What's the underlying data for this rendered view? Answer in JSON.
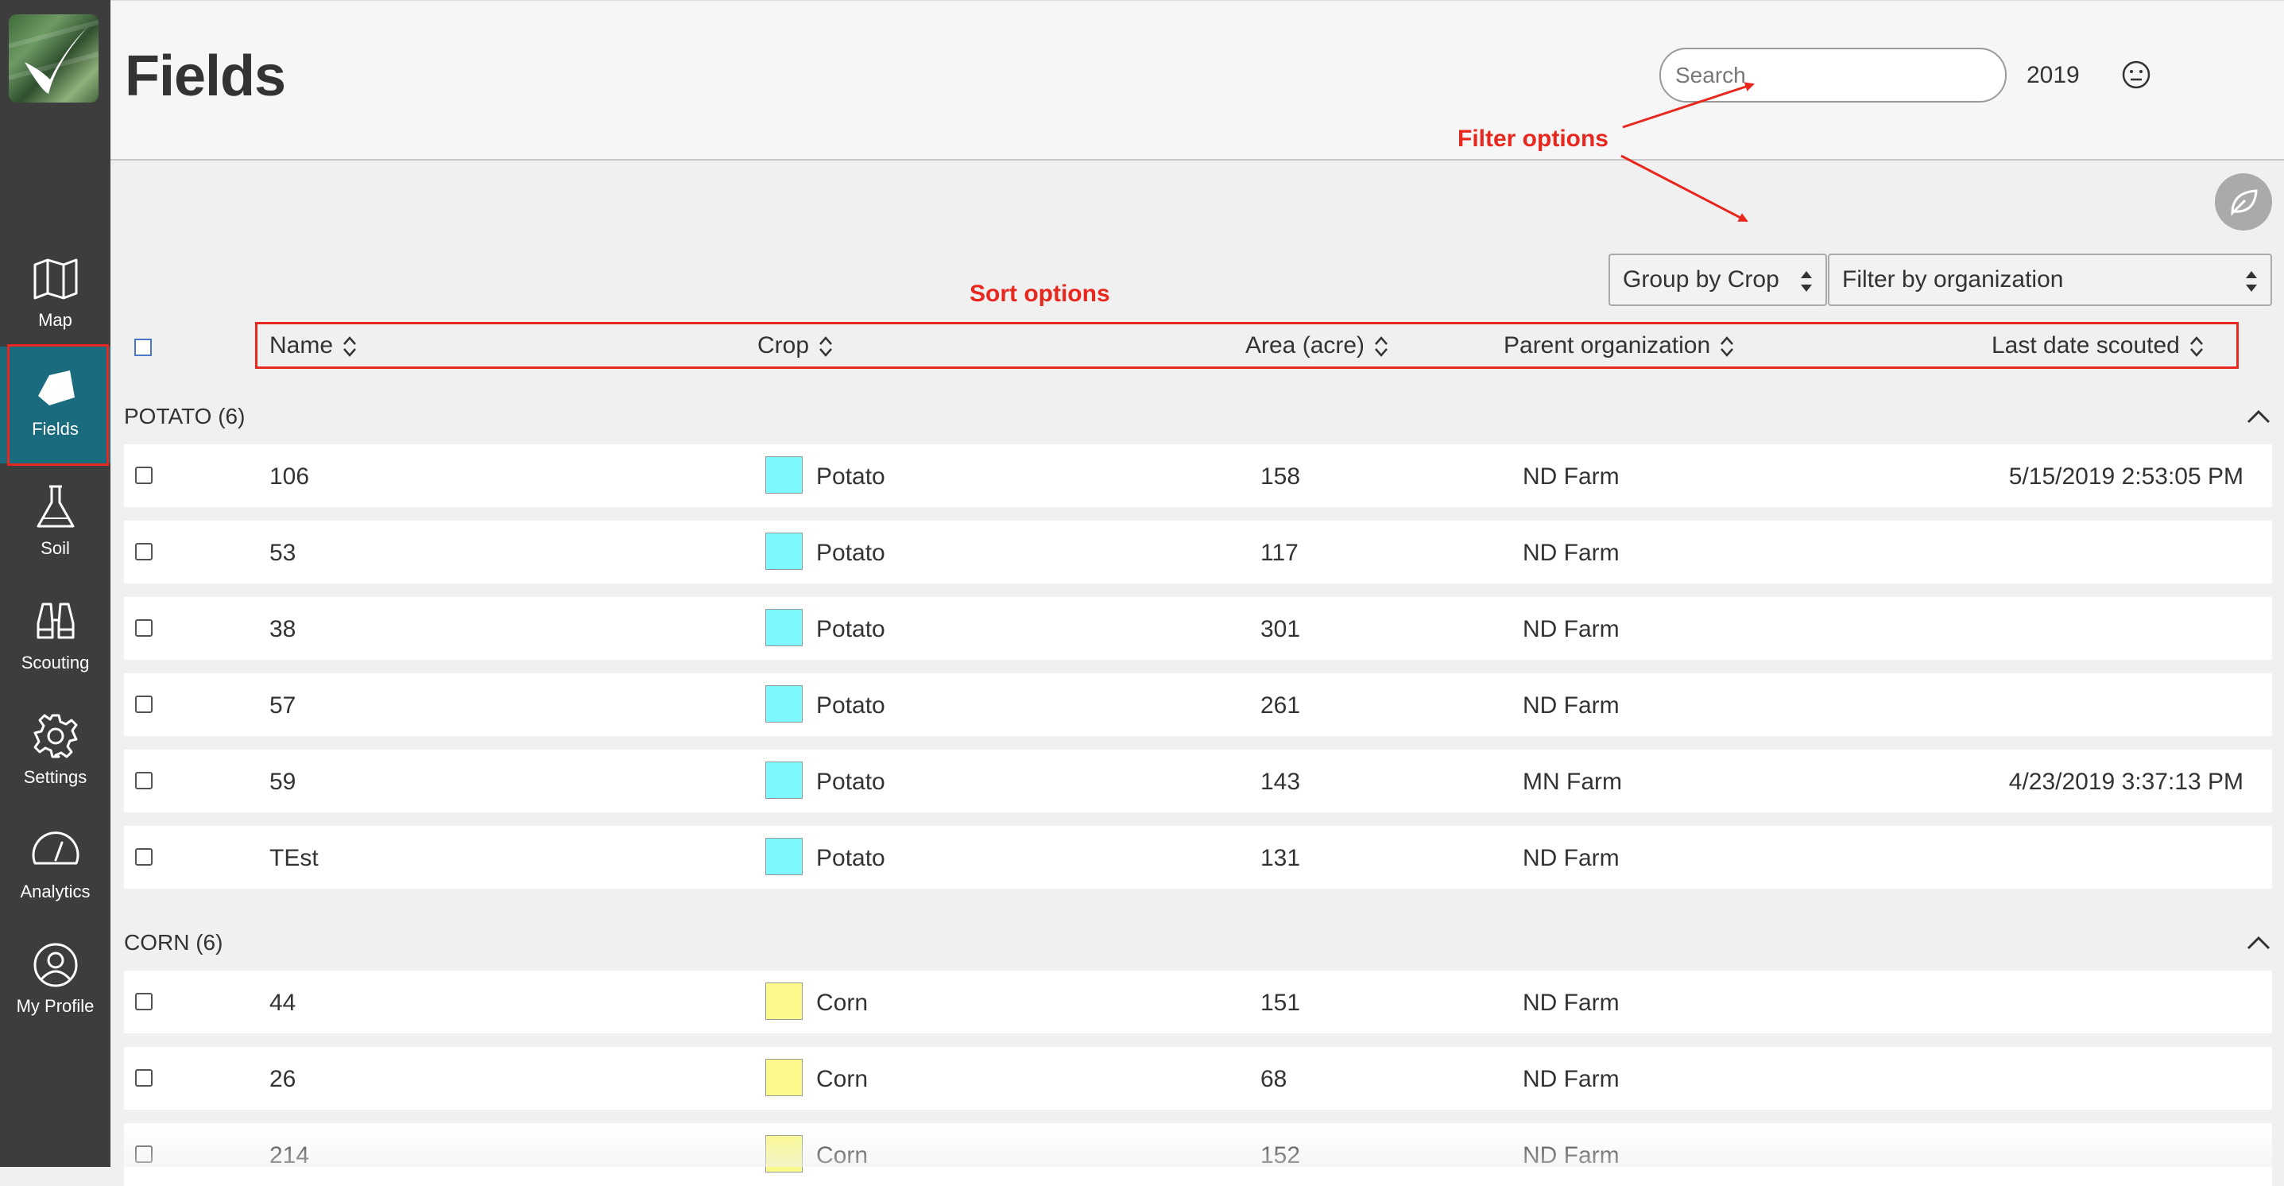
{
  "sidebar": {
    "items": [
      {
        "label": "Map",
        "icon": "map-icon"
      },
      {
        "label": "Fields",
        "icon": "fields-icon",
        "active": true
      },
      {
        "label": "Soil",
        "icon": "flask-icon"
      },
      {
        "label": "Scouting",
        "icon": "binoculars-icon"
      },
      {
        "label": "Settings",
        "icon": "gear-icon"
      },
      {
        "label": "Analytics",
        "icon": "gauge-icon"
      },
      {
        "label": "My Profile",
        "icon": "user-circle-icon"
      }
    ],
    "active_color": "#1a6b7d"
  },
  "header": {
    "title": "Fields",
    "search_placeholder": "Search",
    "year": "2019"
  },
  "annotations": {
    "filter": "Filter options",
    "sort": "Sort options",
    "color": "#e8281e"
  },
  "toolbar": {
    "group_by": "Group by Crop",
    "filter_org": "Filter by organization"
  },
  "columns": {
    "name": "Name",
    "crop": "Crop",
    "area": "Area (acre)",
    "parent": "Parent organization",
    "date": "Last date scouted"
  },
  "groups": [
    {
      "title": "POTATO (6)",
      "color": "#7ef8ff",
      "rows": [
        {
          "name": "106",
          "crop": "Potato",
          "area": "158",
          "org": "ND Farm",
          "date": "5/15/2019 2:53:05 PM"
        },
        {
          "name": "53",
          "crop": "Potato",
          "area": "117",
          "org": "ND Farm",
          "date": ""
        },
        {
          "name": "38",
          "crop": "Potato",
          "area": "301",
          "org": "ND Farm",
          "date": ""
        },
        {
          "name": "57",
          "crop": "Potato",
          "area": "261",
          "org": "ND Farm",
          "date": ""
        },
        {
          "name": "59",
          "crop": "Potato",
          "area": "143",
          "org": "MN Farm",
          "date": "4/23/2019 3:37:13 PM"
        },
        {
          "name": "TEst",
          "crop": "Potato",
          "area": "131",
          "org": "ND Farm",
          "date": ""
        }
      ]
    },
    {
      "title": "CORN (6)",
      "color": "#fbf98a",
      "rows": [
        {
          "name": "44",
          "crop": "Corn",
          "area": "151",
          "org": "ND Farm",
          "date": ""
        },
        {
          "name": "26",
          "crop": "Corn",
          "area": "68",
          "org": "ND Farm",
          "date": ""
        },
        {
          "name": "214",
          "crop": "Corn",
          "area": "152",
          "org": "ND Farm",
          "date": ""
        }
      ]
    }
  ]
}
